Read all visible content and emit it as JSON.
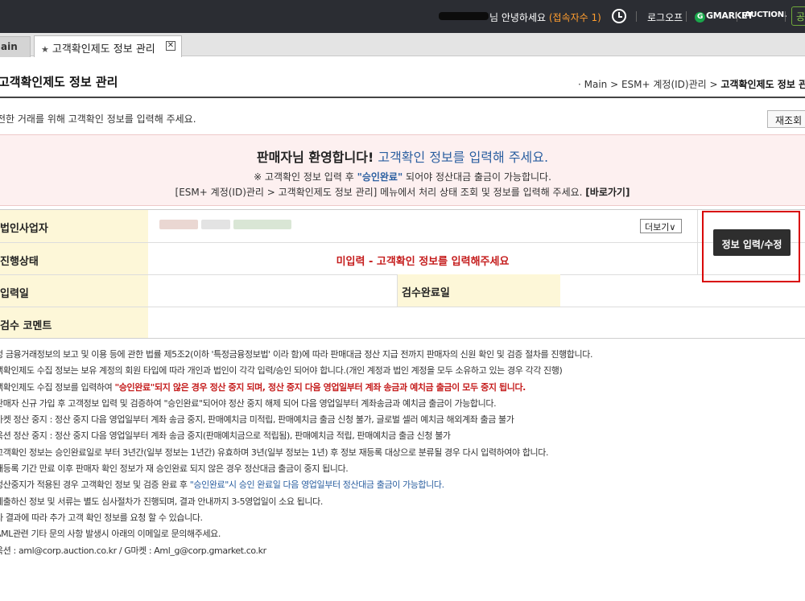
{
  "topbar": {
    "greeting": "님 안녕하세요 ",
    "connection_count": "(접속자수 1)",
    "logout": "로그오프",
    "gmarket": "GMARKET",
    "auction": "AUCTION.",
    "partial_btn": "공"
  },
  "tabs": {
    "main": "ain",
    "active": "고객확인제도 정보 관리",
    "close": "✕"
  },
  "header": {
    "title": "고객확인제도 정보 관리",
    "breadcrumb_prefix": "·  Main > ESM+ 계정(ID)관리 > ",
    "breadcrumb_current": "고객확인제도 정보 관리",
    "description": "전한 거래를 위해 고객확인 정보를 입력해 주세요.",
    "refresh_button": "재조회"
  },
  "notice": {
    "heading": "판매자님 환영합니다!",
    "heading_accent": " 고객확인 정보를 입력해 주세요.",
    "line1_prefix": "※ 고객확인 정보 입력 후 ",
    "line1_accent": "\"승인완료\"",
    "line1_suffix": " 되어야 정산대금 출금이 가능합니다.",
    "line2": "[ESM+ 계정(ID)관리 > 고객확인제도 정보 관리] 메뉴에서 처리 상태 조회 및 정보를 입력해 주세요. ",
    "line2_link": "[바로가기]"
  },
  "info_table": {
    "row1_label": "법인사업자",
    "more_button": "더보기∨",
    "row2_label": "진행상태",
    "status_value": "미입력 - 고객확인 정보를 입력해주세요",
    "row3_label": "입력일",
    "row3_label2": "검수완료일",
    "row4_label": "검수 코멘트",
    "edit_button": "정보 입력/수정"
  },
  "guide": [
    {
      "text": "정 금융거래정보의 보고 및 이용 등에 관한 법률 제5조2(이하 '특정금융정보법' 이라 함)에 따라 판매대금 정산 지급 전까지 판매자의 신원 확인 및 검증 절차를 진행합니다."
    },
    {
      "text": "객확인제도 수집 정보는 보유 계정의 회원 타입에 따라 개인과 법인이 각각 입력/승인 되어야 합니다.(개인 계정과 법인 계정을 모두 소유하고 있는 경우 각각 진행)"
    },
    {
      "text": "객확인제도 수집 정보를 입력하여 ",
      "red": "\"승인완료\"되지 않은 경우 정산 중지 되며, 정산 중지 다음 영업일부터 계좌 송금과 예치금 출금이 모두 중지 됩니다."
    },
    {
      "text": "판매자 신규 가입 후 고객정보 입력 및 검증하여 \"승인완료\"되어야 정산 중지 해제 되어 다음 영업일부터 계좌송금과 예치금 출금이 가능합니다."
    },
    {
      "text": "마켓 정산 중지 : 정산 중지 다음 영업일부터 계좌 송금 중지, 판매예치금 미적립, 판매예치금 출금 신청 불가, 글로벌 셀러 예치금 해외계좌 출금 불가"
    },
    {
      "text": "옥션 정산 중지 : 정산 중지 다음 영업일부터 계좌 송금 중지(판매예치금으로 적립됨), 판매예치금 적립, 판매예치금 출금 신청 불가"
    },
    {
      "text": "고객확인 정보는 승인완료일로 부터 3년간(일부 정보는 1년간) 유효하며 3년(일부 정보는 1년) 후 정보 재등록 대상으로 분류될 경우 다시 입력하여야 합니다."
    },
    {
      "text": "재등록 기간 만료 이후 판매자 확인 정보가 재 승인완료 되지 않은 경우 정산대금 출금이 중지 됩니다."
    },
    {
      "text": "정산중지가 적용된 경우 고객확인 정보 및 검증 완료 후 ",
      "blue": "\"승인완료\"시 승인 완료일 다음 영업일부터 정산대금 출금이 가능합니다."
    },
    {
      "text": "제출하신 정보 및 서류는 별도 심사절차가 진행되며, 결과 안내까지 3-5영업일이 소요 됩니다."
    },
    {
      "text": "사 결과에 따라 추가 고객 확인 정보를 요청 할 수 있습니다."
    },
    {
      "text": "AML관련 기타 문의 사항 발생시 아래의 이메일로 문의해주세요."
    },
    {
      "text": "옥션 : aml@corp.auction.co.kr / G마켓 : Aml_g@corp.gmarket.co.kr"
    }
  ],
  "colors": {
    "topbar_bg": "#2b2d33",
    "notice_bg": "#fdf0f0",
    "table_header_bg": "#fdf7d8",
    "status_red": "#c51d1d",
    "accent_blue": "#2b5fa0",
    "highlight_box": "#d90000",
    "edit_button_bg": "#2e2e2e"
  }
}
